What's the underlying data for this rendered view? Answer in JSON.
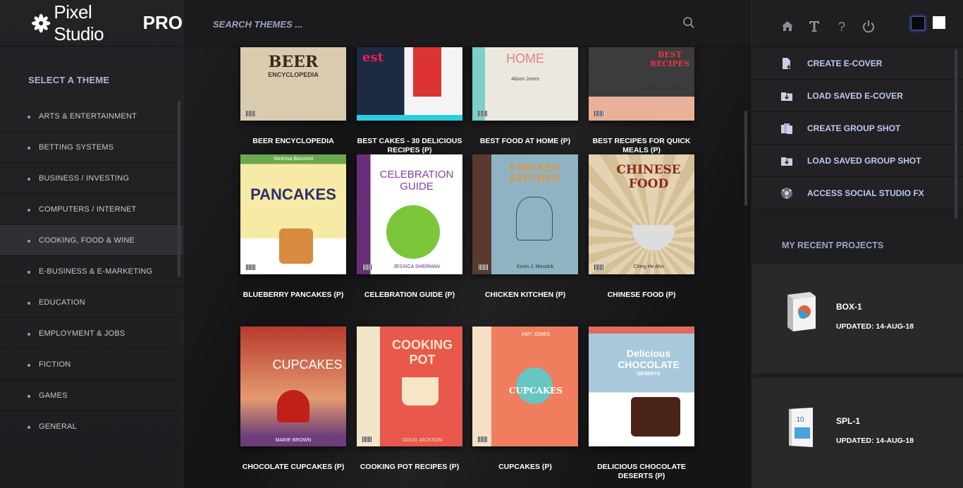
{
  "brand": {
    "name": "Pixel Studio",
    "suffix": "PRO"
  },
  "sidebar": {
    "title": "SELECT A THEME",
    "items": [
      {
        "label": "ARTS & ENTERTAINMENT"
      },
      {
        "label": "BETTING SYSTEMS"
      },
      {
        "label": "BUSINESS / INVESTING"
      },
      {
        "label": "COMPUTERS / INTERNET"
      },
      {
        "label": "COOKING, FOOD & WINE",
        "active": true
      },
      {
        "label": "E-BUSINESS & E-MARKETING"
      },
      {
        "label": "EDUCATION"
      },
      {
        "label": "EMPLOYMENT & JOBS"
      },
      {
        "label": "FICTION"
      },
      {
        "label": "GAMES"
      },
      {
        "label": "GENERAL"
      }
    ]
  },
  "search": {
    "placeholder": "SEARCH THEMES ..."
  },
  "themes": [
    {
      "label": "BEER ENCYCLOPEDIA",
      "cover_title": "BEER",
      "cover_sub": "ENCYCLOPEDIA",
      "bg": "#d8cbb0"
    },
    {
      "label": "BEST CAKES - 30 DELICIOUS RECIPES (P)",
      "cover_title": "est",
      "cover_sub": "",
      "bg": "#f4f4f4"
    },
    {
      "label": "BEST FOOD AT HOME (P)",
      "cover_title": "HOME",
      "cover_sub": "Alison Jones",
      "bg": "#e8e6df"
    },
    {
      "label": "BEST RECIPES FOR QUICK MEALS (P)",
      "cover_title": "BEST RECIPES",
      "cover_sub": "MARISA HEART",
      "bg": "#333"
    },
    {
      "label": "BLUEBERRY PANCAKES (P)",
      "cover_title": "PANCAKES",
      "cover_sub": "Vanessa Baumont",
      "bg": "#f7e9a6"
    },
    {
      "label": "CELEBRATION GUIDE (P)",
      "cover_title": "CELEBRATION GUIDE",
      "cover_sub": "JESSICA SHERMAN",
      "bg": "#fff"
    },
    {
      "label": "CHICKEN KITCHEN (P)",
      "cover_title": "CHICKEN KITCHEN",
      "cover_sub": "Kevin J. Messick",
      "bg": "#8fb3c3"
    },
    {
      "label": "CHINESE FOOD (P)",
      "cover_title": "CHINESE FOOD",
      "cover_sub": "Ching He Ahn",
      "bg": "#e3d3b2"
    },
    {
      "label": "CHOCOLATE CUPCAKES (P)",
      "cover_title": "CUPCAKES",
      "cover_sub": "MARIE BROWN",
      "bg": "#c9503d"
    },
    {
      "label": "COOKING POT RECIPES (P)",
      "cover_title": "COOKING POT",
      "cover_sub": "DOUG JACKSON",
      "bg": "#e8584c"
    },
    {
      "label": "CUPCAKES (P)",
      "cover_title": "CUPCAKES",
      "cover_sub": "AMY JONES",
      "bg": "#f07e5e"
    },
    {
      "label": "DELICIOUS CHOCOLATE DESERTS (P)",
      "cover_title": "Delicious CHOCOLATE",
      "cover_sub": "DESERTS",
      "bg": "#a9c8dc"
    }
  ],
  "right": {
    "actions": [
      {
        "label": "CREATE E-COVER",
        "icon": "file-plus-icon"
      },
      {
        "label": "LOAD SAVED E-COVER",
        "icon": "folder-load-icon"
      },
      {
        "label": "CREATE GROUP SHOT",
        "icon": "group-files-icon"
      },
      {
        "label": "LOAD SAVED GROUP SHOT",
        "icon": "folder-load-icon"
      },
      {
        "label": "ACCESS SOCIAL STUDIO FX",
        "icon": "social-icon"
      }
    ],
    "recent_title": "MY RECENT PROJECTS",
    "projects": [
      {
        "name": "BOX-1",
        "updated": "UPDATED: 14-AUG-18"
      },
      {
        "name": "SPL-1",
        "updated": "UPDATED: 14-AUG-18"
      }
    ]
  }
}
